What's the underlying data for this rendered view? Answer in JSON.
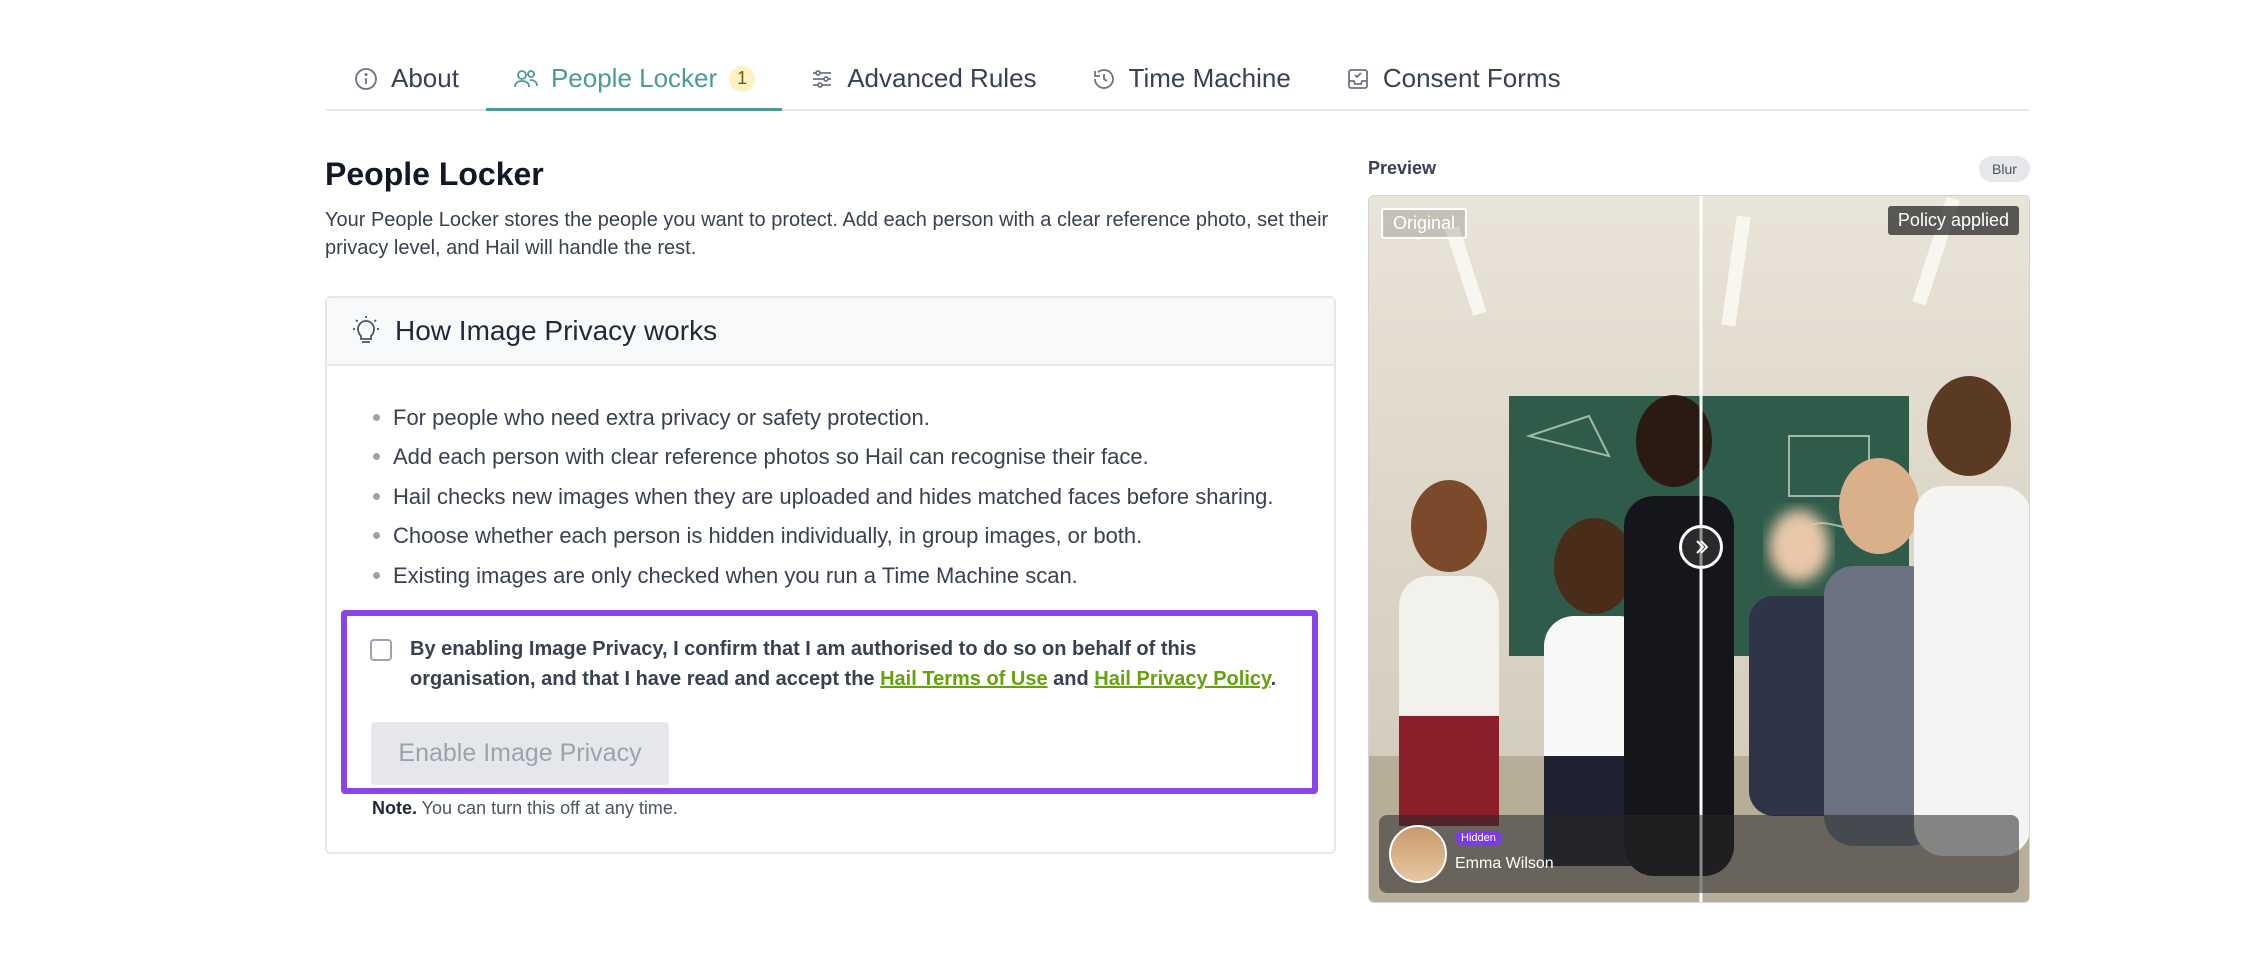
{
  "tabs": [
    {
      "label": "About",
      "icon": "info-icon"
    },
    {
      "label": "People Locker",
      "icon": "people-icon",
      "badge": "1",
      "active": true
    },
    {
      "label": "Advanced Rules",
      "icon": "sliders-icon"
    },
    {
      "label": "Time Machine",
      "icon": "history-icon"
    },
    {
      "label": "Consent Forms",
      "icon": "inbox-icon"
    }
  ],
  "main": {
    "title": "People Locker",
    "intro": "Your People Locker stores the people you want to protect. Add each person with a clear reference photo, set their privacy level, and Hail will handle the rest.",
    "how_title": "How Image Privacy works",
    "bullets": [
      "For people who need extra privacy or safety protection.",
      "Add each person with clear reference photos so Hail can recognise their face.",
      "Hail checks new images when they are uploaded and hides matched faces before sharing.",
      "Choose whether each person is hidden individually, in group images, or both.",
      "Existing images are only checked when you run a Time Machine scan."
    ],
    "consent": {
      "text_before": "By enabling Image Privacy, I confirm that I am authorised to do so on behalf of this organisation, and that I have read and accept the ",
      "terms_link": "Hail Terms of Use",
      "and": " and ",
      "privacy_link": "Hail Privacy Policy",
      "end": ".",
      "checked": false
    },
    "enable_button": "Enable Image Privacy",
    "note_label": "Note.",
    "note_text": " You can turn this off at any time."
  },
  "preview": {
    "label": "Preview",
    "mode": "Blur",
    "original_tag": "Original",
    "policy_tag": "Policy applied",
    "person": {
      "status": "Hidden",
      "name": "Emma Wilson"
    }
  },
  "colors": {
    "accent": "#4a9c94",
    "highlight": "#8b45e6",
    "link": "#65a30d"
  }
}
